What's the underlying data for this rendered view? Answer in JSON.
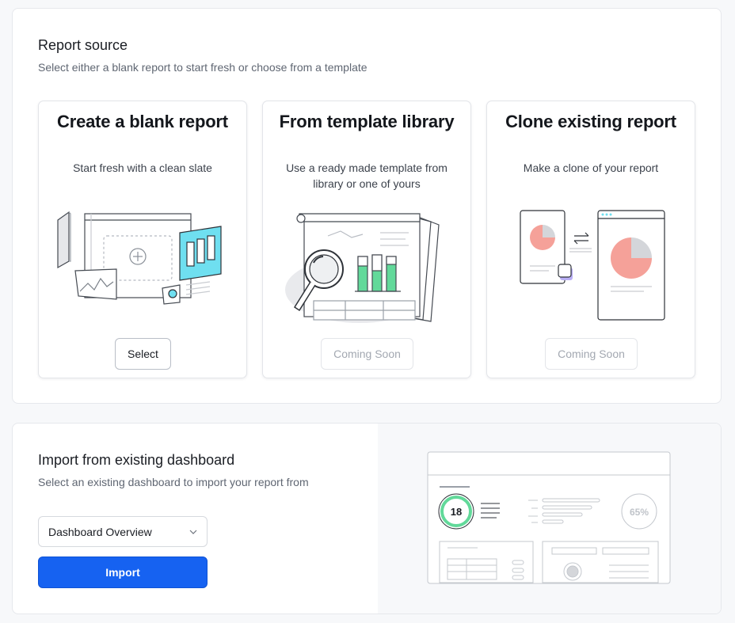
{
  "report_source": {
    "title": "Report source",
    "subtitle": "Select either a blank report to start fresh or choose from a template",
    "cards": [
      {
        "title": "Create a blank report",
        "description": "Start fresh with a clean slate",
        "button": "Select",
        "illustration": "blank-report-illustration"
      },
      {
        "title": "From template library",
        "description": "Use a ready made template from library or one of yours",
        "button": "Coming Soon",
        "illustration": "template-library-illustration"
      },
      {
        "title": "Clone existing report",
        "description": "Make a clone of your report",
        "button": "Coming Soon",
        "illustration": "clone-report-illustration"
      }
    ]
  },
  "import_section": {
    "title": "Import from existing dashboard",
    "subtitle": "Select an existing dashboard to import your report from",
    "dropdown_value": "Dashboard Overview",
    "import_button": "Import",
    "preview": {
      "score": "18",
      "percent": "65%"
    }
  },
  "colors": {
    "primary": "#1662f1",
    "accent_cyan": "#6fdff0",
    "accent_green": "#62d99a",
    "accent_salmon": "#f5a199",
    "accent_purple": "#b9aef5"
  }
}
